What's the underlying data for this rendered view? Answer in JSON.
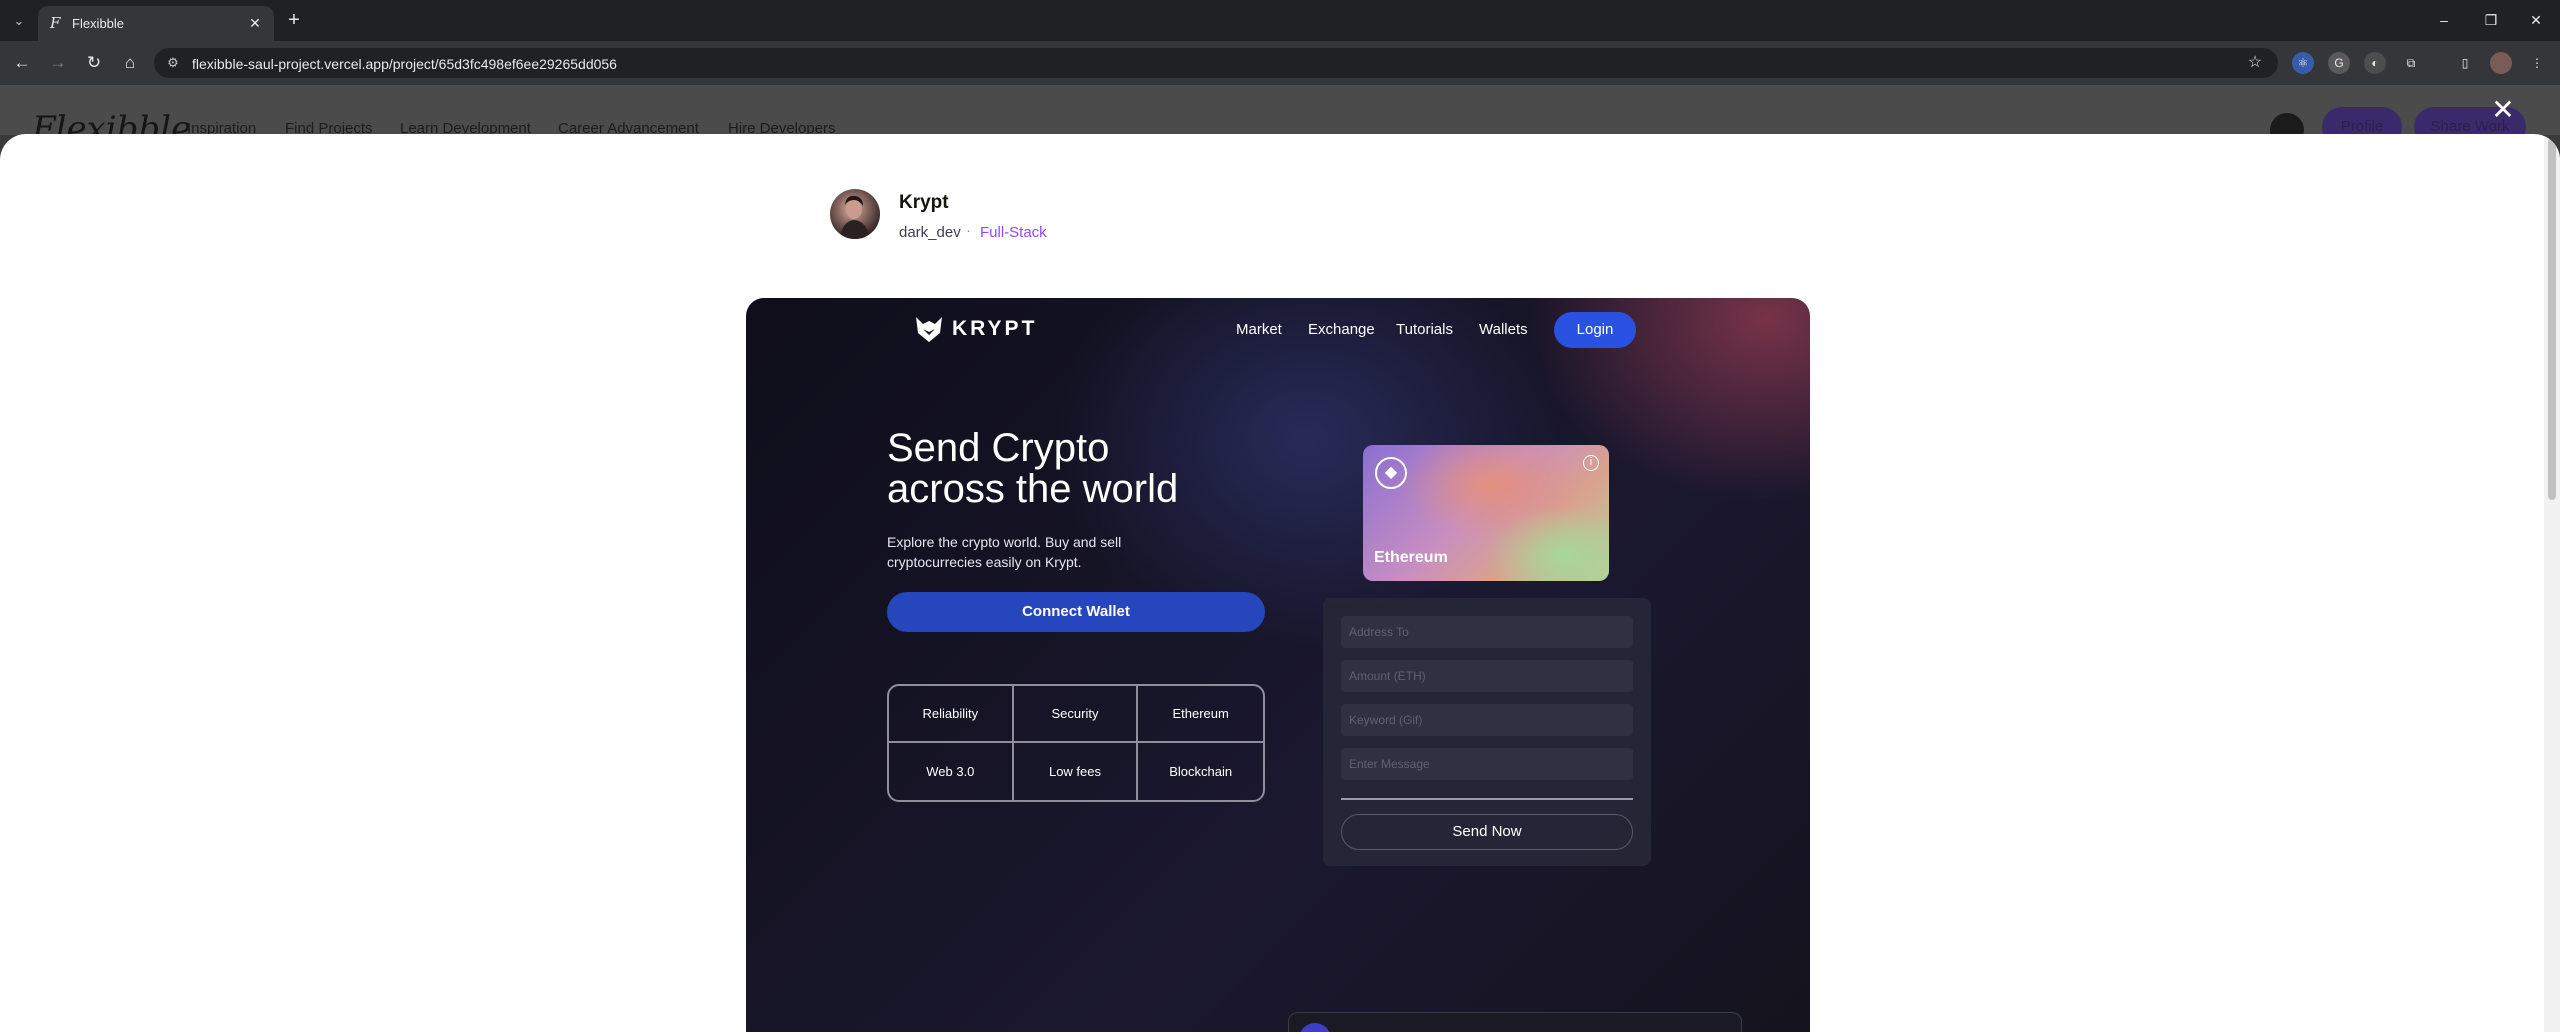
{
  "browser": {
    "tab_title": "Flexibble",
    "url": "flexibble-saul-project.vercel.app/project/65d3fc498ef6ee29265dd056",
    "tab_close": "✕",
    "new_tab": "+",
    "controls": {
      "minimize": "–",
      "restore": "❐",
      "close": "✕"
    }
  },
  "site": {
    "logo": "Flexibble",
    "nav": [
      "Inspiration",
      "Find Projects",
      "Learn Development",
      "Career Advancement",
      "Hire Developers"
    ],
    "profile_button": "Profile",
    "share_button": "Share Work"
  },
  "modal": {
    "close_icon": "✕",
    "project_title": "Krypt",
    "author": "dark_dev",
    "separator": "·",
    "category": "Full-Stack"
  },
  "preview": {
    "logo_text": "KRYPT",
    "nav": [
      "Market",
      "Exchange",
      "Tutorials",
      "Wallets"
    ],
    "login": "Login",
    "headline_1": "Send Crypto",
    "headline_2": "across the world",
    "subtitle": "Explore the crypto world. Buy and sell cryptocurrecies easily on Krypt.",
    "connect_wallet": "Connect Wallet",
    "features": [
      "Reliability",
      "Security",
      "Ethereum",
      "Web 3.0",
      "Low fees",
      "Blockchain"
    ],
    "card_label": "Ethereum",
    "card_eth_icon": "◆",
    "card_info_icon": "i",
    "inputs": [
      "Address To",
      "Amount (ETH)",
      "Keyword (Gif)",
      "Enter Message"
    ],
    "send_button": "Send Now"
  },
  "colors": {
    "accent_purple": "#9747ff",
    "krypt_blue": "#2952e3"
  }
}
